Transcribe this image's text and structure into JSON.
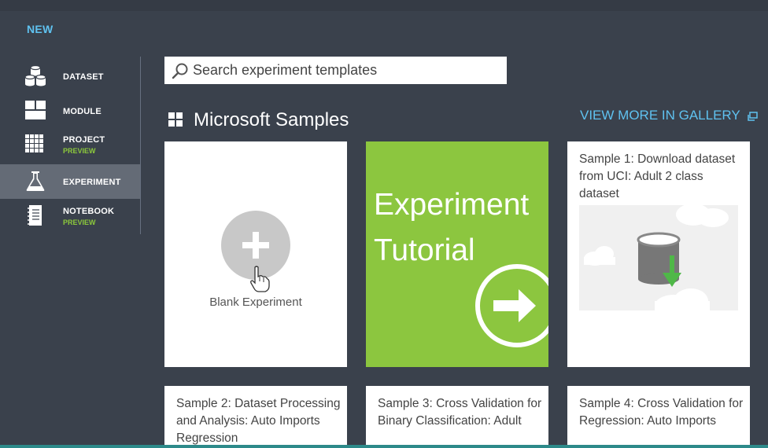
{
  "header": {
    "new_label": "NEW"
  },
  "sidebar": {
    "items": [
      {
        "label": "DATASET",
        "sub": "",
        "icon": "dataset-icon"
      },
      {
        "label": "MODULE",
        "sub": "",
        "icon": "module-icon"
      },
      {
        "label": "PROJECT",
        "sub": "PREVIEW",
        "icon": "project-icon"
      },
      {
        "label": "EXPERIMENT",
        "sub": "",
        "icon": "experiment-flask-icon",
        "selected": true
      },
      {
        "label": "NOTEBOOK",
        "sub": "PREVIEW",
        "icon": "notebook-icon"
      }
    ]
  },
  "search": {
    "placeholder": "Search experiment templates",
    "value": ""
  },
  "section": {
    "title": "Microsoft Samples",
    "view_more": "VIEW MORE IN GALLERY"
  },
  "tiles": {
    "blank": {
      "label": "Blank Experiment"
    },
    "tutorial": {
      "line1": "Experiment",
      "line2": "Tutorial"
    },
    "sample1": {
      "text": "Sample 1: Download dataset from UCI: Adult 2 class dataset"
    },
    "sample2": {
      "text": "Sample 2: Dataset Processing and Analysis: Auto Imports Regression"
    },
    "sample3": {
      "text": "Sample 3: Cross Validation for Binary Classification: Adult"
    },
    "sample4": {
      "text": "Sample 4: Cross Validation for Regression: Auto Imports"
    }
  },
  "colors": {
    "accent": "#5fc2f0",
    "green": "#8cc63f",
    "background": "#3a414c",
    "selected": "#646b76"
  }
}
